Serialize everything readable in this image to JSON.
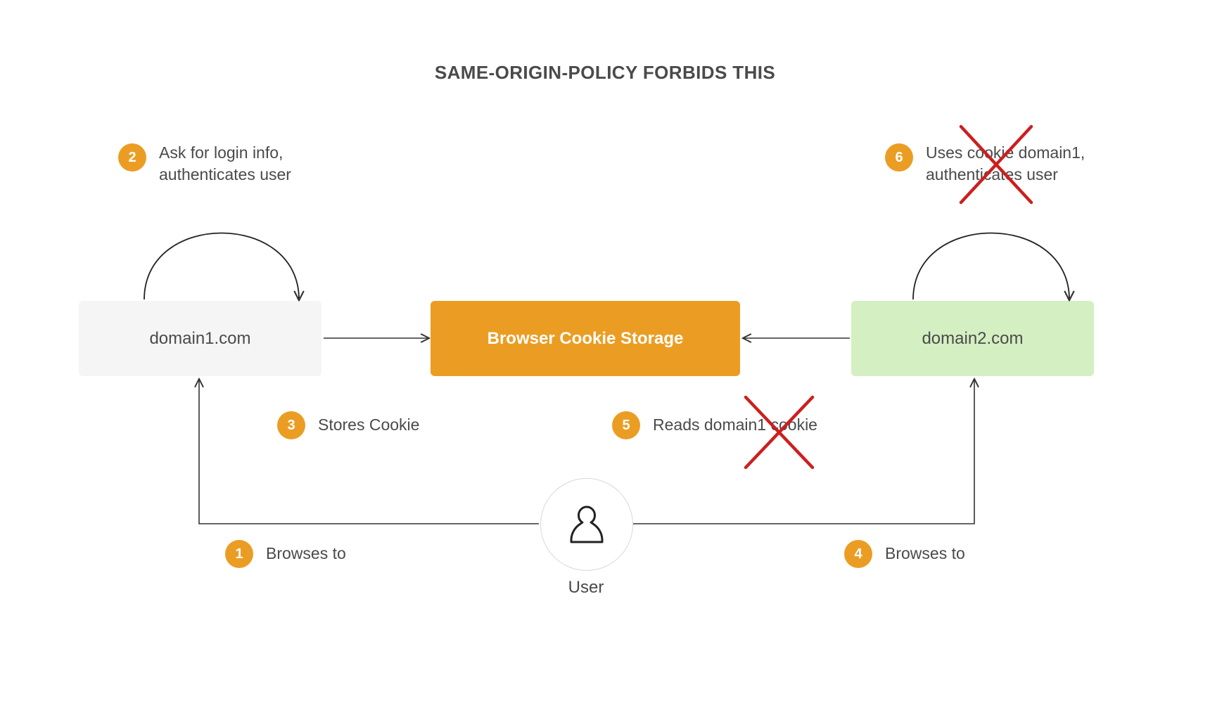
{
  "title": "SAME-ORIGIN-POLICY FORBIDS THIS",
  "nodes": {
    "domain1": "domain1.com",
    "storage": "Browser Cookie Storage",
    "domain2": "domain2.com",
    "user": "User"
  },
  "steps": {
    "s1": {
      "num": "1",
      "text": "Browses to"
    },
    "s2": {
      "num": "2",
      "text": "Ask for login info,\nauthenticates user"
    },
    "s3": {
      "num": "3",
      "text": "Stores Cookie"
    },
    "s4": {
      "num": "4",
      "text": "Browses to"
    },
    "s5": {
      "num": "5",
      "text": "Reads domain1 cookie"
    },
    "s6": {
      "num": "6",
      "text": "Uses cookie domain1,\nauthenticates user"
    }
  },
  "colors": {
    "accent": "#eb9d23",
    "green": "#d4efc2",
    "grey": "#f5f5f5",
    "cross": "#cc1f1f",
    "stroke": "#333333"
  }
}
